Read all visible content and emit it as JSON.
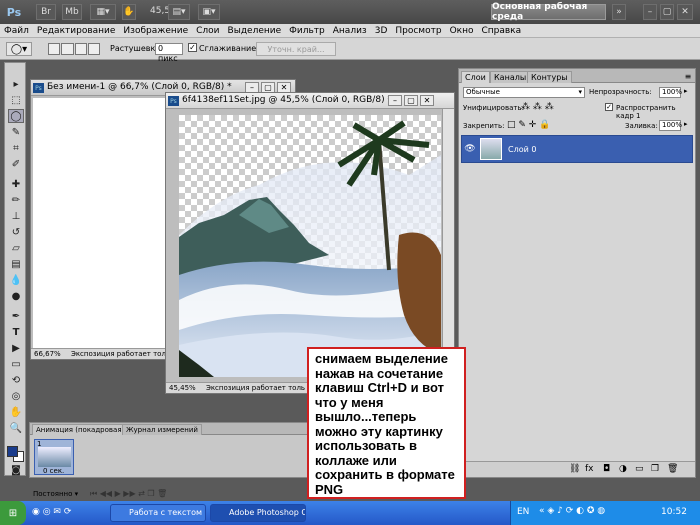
{
  "app": {
    "logo": "Ps",
    "buttons": [
      "Br",
      "Mb"
    ],
    "zoom": "45,5",
    "workspace": "Основная рабочая среда"
  },
  "menu": [
    "Файл",
    "Редактирование",
    "Изображение",
    "Слои",
    "Выделение",
    "Фильтр",
    "Анализ",
    "3D",
    "Просмотр",
    "Окно",
    "Справка"
  ],
  "options": {
    "feather_label": "Растушевка:",
    "feather_value": "0 пикс",
    "smooth_label": "Сглаживание",
    "refine_label": "Уточн. край..."
  },
  "doc1": {
    "title": "Без имени-1 @ 66,7% (Слой 0, RGB/8) *",
    "zoom": "66,67%",
    "status": "Экспозиция работает тол"
  },
  "doc2": {
    "title": "6f4138ef11Set.jpg @ 45,5% (Слой 0, RGB/8) *",
    "zoom": "45,45%",
    "status": "Экспозиция работает толь"
  },
  "panel": {
    "tabs": [
      "Слои",
      "Каналы",
      "Контуры"
    ],
    "blend_mode": "Обычные",
    "opacity_label": "Непрозрачность:",
    "opacity": "100%",
    "unify_label": "Унифицировать:",
    "propagate_label": "Распространить кадр 1",
    "lock_label": "Закрепить:",
    "fill_label": "Заливка:",
    "fill": "100%",
    "layer_name": "Слой 0"
  },
  "anim": {
    "tabs": [
      "Анимация (покадровая)",
      "Журнал измерений"
    ],
    "frame_num": "1",
    "frame_time": "0 сек.",
    "loop": "Постоянно"
  },
  "taskbar": {
    "lang": "EN",
    "clock": "10:52",
    "tasks": [
      "Работа с текстом в ...",
      "Adobe Photoshop CS..."
    ]
  },
  "note": "снимаем выделение нажав на сочетание клавиш  Ctrl+D  и вот что у меня вышло...теперь можно эту картинку использовать в коллаже или сохранить в формате PNG"
}
